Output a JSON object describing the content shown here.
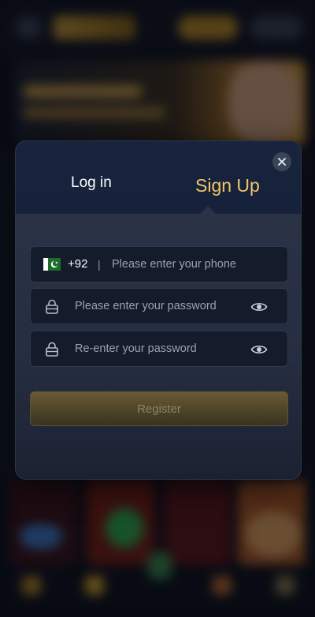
{
  "modal": {
    "tabs": [
      {
        "label": "Log in",
        "active": false
      },
      {
        "label": "Sign Up",
        "active": true
      }
    ],
    "close_icon": "close-icon"
  },
  "form": {
    "phone": {
      "country_flag": "pakistan-flag-icon",
      "country_code": "+92",
      "separator": "|",
      "placeholder": "Please enter your phone"
    },
    "password": {
      "placeholder": "Please enter your password",
      "lock_icon": "lock-icon",
      "visibility_icon": "eye-icon"
    },
    "confirm_password": {
      "placeholder": "Re-enter your password",
      "lock_icon": "lock-icon",
      "visibility_icon": "eye-icon"
    },
    "register_label": "Register"
  },
  "colors": {
    "accent_gold": "#f0c66b",
    "modal_bg": "#1a2236",
    "field_bg": "#141b2a"
  }
}
